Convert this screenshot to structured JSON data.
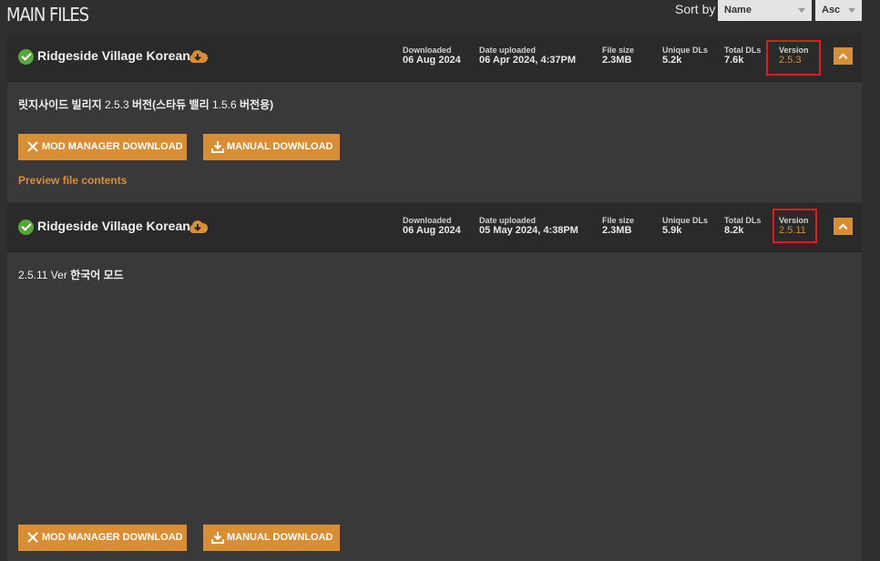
{
  "header": {
    "title": "MAIN FILES",
    "sort_label": "Sort by",
    "sort_field": "Name",
    "sort_order": "Asc"
  },
  "stat_labels": {
    "downloaded": "Downloaded",
    "date_uploaded": "Date uploaded",
    "file_size": "File size",
    "unique_dls": "Unique DLs",
    "total_dls": "Total DLs",
    "version": "Version"
  },
  "files": [
    {
      "name": "Ridgeside Village Korean",
      "downloaded": "06 Aug 2024",
      "date_uploaded": "06 Apr 2024, 4:37PM",
      "file_size": "2.3MB",
      "unique_dls": "5.2k",
      "total_dls": "7.6k",
      "version": "2.5.3",
      "description_parts": [
        {
          "text": "릿지사이드 빌리지",
          "bold": true
        },
        {
          "text": " 2.5.3 ",
          "bold": false
        },
        {
          "text": "버전(스타듀 밸리",
          "bold": true
        },
        {
          "text": " 1.5.6 ",
          "bold": false
        },
        {
          "text": "버전용)",
          "bold": true
        }
      ],
      "mod_manager_label": "MOD MANAGER DOWNLOAD",
      "manual_label": "MANUAL DOWNLOAD",
      "preview_label": "Preview file contents"
    },
    {
      "name": "Ridgeside Village Korean",
      "downloaded": "06 Aug 2024",
      "date_uploaded": "05 May 2024, 4:38PM",
      "file_size": "2.3MB",
      "unique_dls": "5.9k",
      "total_dls": "8.2k",
      "version": "2.5.11",
      "description_parts": [
        {
          "text": "2.5.11 Ver ",
          "bold": false
        },
        {
          "text": "한국어 모드",
          "bold": true
        }
      ],
      "mod_manager_label": "MOD MANAGER DOWNLOAD",
      "manual_label": "MANUAL DOWNLOAD"
    }
  ],
  "colors": {
    "accent": "#d98e33",
    "highlight": "#e01b24",
    "success": "#57a639"
  }
}
